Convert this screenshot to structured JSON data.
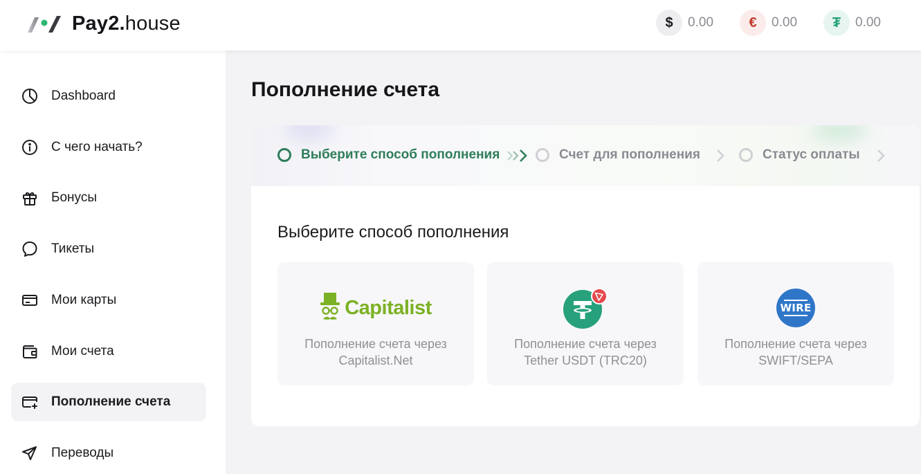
{
  "header": {
    "logo_bold": "Pay2.",
    "logo_light": "house",
    "balances": [
      {
        "icon": "dollar-icon",
        "symbol": "$",
        "value": "0.00",
        "color": "#1b1b1f",
        "bg": "#eeeef1"
      },
      {
        "icon": "euro-icon",
        "symbol": "€",
        "value": "0.00",
        "color": "#c0392b",
        "bg": "#fbeceb"
      },
      {
        "icon": "tether-icon",
        "symbol": "₮",
        "value": "0.00",
        "color": "#26a17b",
        "bg": "#e6f5ef"
      }
    ]
  },
  "sidebar": {
    "items": [
      {
        "label": "Dashboard",
        "icon": "pie-chart-icon"
      },
      {
        "label": "С чего начать?",
        "icon": "info-icon"
      },
      {
        "label": "Бонусы",
        "icon": "gift-icon"
      },
      {
        "label": "Тикеты",
        "icon": "chat-icon"
      },
      {
        "label": "Мои карты",
        "icon": "cards-icon"
      },
      {
        "label": "Мои счета",
        "icon": "wallet-icon"
      },
      {
        "label": "Пополнение счета",
        "icon": "card-add-icon",
        "active": true
      },
      {
        "label": "Переводы",
        "icon": "send-icon"
      }
    ]
  },
  "main": {
    "title": "Пополнение счета",
    "steps": [
      {
        "label": "Выберите способ пополнения",
        "active": true
      },
      {
        "label": "Счет для пополнения",
        "active": false
      },
      {
        "label": "Статус оплаты",
        "active": false
      }
    ],
    "section_title": "Выберите способ пополнения",
    "methods": [
      {
        "logo_text": "Capitalist",
        "icon": "capitalist-logo-icon",
        "line1": "Пополнение счета через",
        "line2": "Capitalist.Net"
      },
      {
        "logo_text": "",
        "icon": "tether-trc20-icon",
        "line1": "Пополнение счета через",
        "line2": "Tether USDT (TRC20)"
      },
      {
        "logo_text": "WIRE",
        "icon": "wire-icon",
        "line1": "Пополнение счета через",
        "line2": "SWIFT/SEPA"
      }
    ]
  },
  "colors": {
    "accent_green": "#2e7d5a",
    "capitalist_green": "#7bb124",
    "tether_green": "#26a17b",
    "wire_blue": "#2f76c8"
  }
}
